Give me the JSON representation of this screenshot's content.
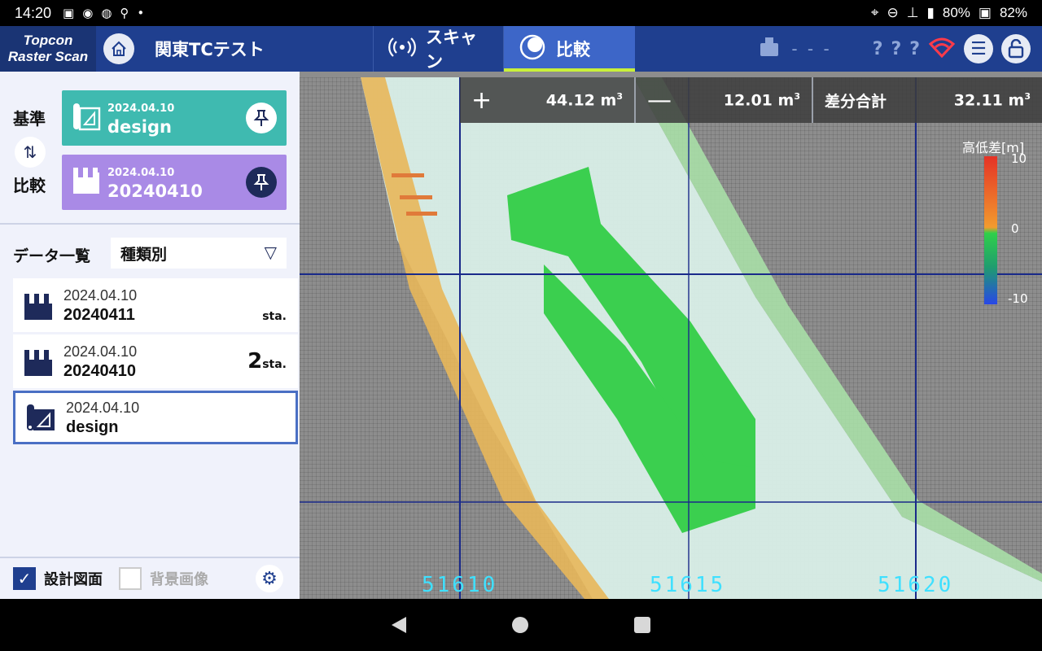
{
  "status_bar": {
    "time": "14:20",
    "battery_1": "80%",
    "battery_2": "82%"
  },
  "app": {
    "brand_line1": "Topcon",
    "brand_line2": "Raster Scan",
    "project_title": "関東TCテスト",
    "tabs": [
      {
        "label": "スキャン"
      },
      {
        "label": "比較"
      }
    ],
    "device_status": "- - -",
    "help_marks": [
      "?",
      "?",
      "?"
    ]
  },
  "compare": {
    "base_label": "基準",
    "compare_label": "比較",
    "base": {
      "date": "2024.04.10",
      "name": "design"
    },
    "target": {
      "date": "2024.04.10",
      "name": "20240410"
    }
  },
  "data_list": {
    "title": "データ一覧",
    "filter": "種類別",
    "items": [
      {
        "date": "2024.04.10",
        "name": "20240411",
        "sta_num": "",
        "sta": "sta."
      },
      {
        "date": "2024.04.10",
        "name": "20240410",
        "sta_num": "2",
        "sta": "sta."
      },
      {
        "date": "2024.04.10",
        "name": "design",
        "sta_num": "",
        "sta": ""
      }
    ]
  },
  "options": {
    "design_drawing": "設計図面",
    "background_image": "背景画像"
  },
  "volumes": {
    "cut": {
      "symbol": "+",
      "value": "44.12",
      "unit": "m",
      "sup": "3"
    },
    "fill": {
      "symbol": "—",
      "value": "12.01",
      "unit": "m",
      "sup": "3"
    },
    "total": {
      "label": "差分合計",
      "value": "32.11",
      "unit": "m",
      "sup": "3"
    }
  },
  "legend": {
    "title": "高低差[m]",
    "max": "10",
    "mid": "0",
    "min": "-10"
  },
  "coords": [
    "51610",
    "51615",
    "51620"
  ],
  "colors": {
    "appbar": "#1f3f8f",
    "active_tab": "#3d66c8",
    "base_card": "#3fbab0",
    "compare_card": "#a98ae6",
    "coord_text": "#3fe0ff"
  }
}
